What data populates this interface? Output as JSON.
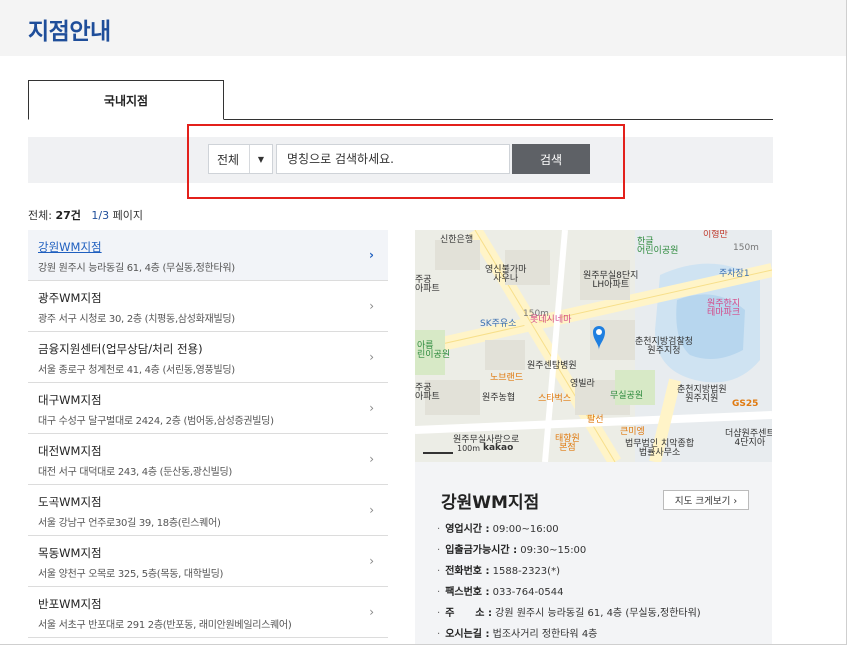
{
  "page": {
    "title": "지점안내"
  },
  "tabs": [
    {
      "label": "국내지점",
      "active": true
    }
  ],
  "search": {
    "category_selected": "전체",
    "dropdown_arrow": "▼",
    "placeholder": "명칭으로 검색하세요.",
    "button_label": "검색"
  },
  "summary": {
    "total_label": "전체:",
    "total_count": "27건",
    "page_current": "1/3",
    "page_suffix": "페이지"
  },
  "branches": [
    {
      "name": "강원WM지점",
      "address": "강원 원주시 능라동길 61, 4층 (무실동,정한타워)",
      "active": true
    },
    {
      "name": "광주WM지점",
      "address": "광주 서구 시청로 30, 2층 (치평동,삼성화재빌딩)",
      "active": false
    },
    {
      "name": "금융지원센터(업무상담/처리 전용)",
      "address": "서울 종로구 청계천로 41, 4층 (서린동,영풍빌딩)",
      "active": false
    },
    {
      "name": "대구WM지점",
      "address": "대구 수성구 달구벌대로 2424, 2층 (범어동,삼성증권빌딩)",
      "active": false
    },
    {
      "name": "대전WM지점",
      "address": "대전 서구 대덕대로 243, 4층 (둔산동,광신빌딩)",
      "active": false
    },
    {
      "name": "도곡WM지점",
      "address": "서울 강남구 언주로30길 39, 18층(린스퀘어)",
      "active": false
    },
    {
      "name": "목동WM지점",
      "address": "서울 양천구 오목로 325, 5층(목동, 대학빌딩)",
      "active": false
    },
    {
      "name": "반포WM지점",
      "address": "서울 서초구 반포대로 291 2층(반포동, 래미안원베일리스퀘어)",
      "active": false
    }
  ],
  "chevron": "›",
  "map": {
    "labels": {
      "shinhan": "신한은행",
      "hangeul_park": "한글\n어린이공원",
      "dist_150_top": "150m",
      "parking": "주차장1",
      "yeongshin": "영신불가마\n사우나",
      "wonju_musil": "원주무실8단지\nLH아파트",
      "wonju_theme": "원주한지\n테마파크",
      "apt_left": "주공\n아파트",
      "sk": "SK주유소",
      "lotte": "롯데시네마",
      "chuncheon_police": "춘천지방검찰청\n원주지청",
      "areum_park": "아름\n린이공원",
      "wonju_hosp": "원주센탐병원",
      "noteuraend": "노브랜드",
      "yeongbilla": "영빌라",
      "musil_park": "무실공원",
      "chuncheon_court": "춘천지방법원\n원주지원",
      "gs25": "GS25",
      "apt_left2": "주공\n아파트",
      "wonju_nonghyup": "원주농협",
      "starbucks": "스타벅스",
      "palsan": "팔선",
      "geumirung": "큰미엥",
      "deoksan": "더샵원주센트\n4단지아",
      "musil_sarang": "원주무실사랑으로",
      "taehyang": "태향원\n본점",
      "beopmu": "법무법인 치악종합\n법률사무소",
      "scale": "100m",
      "kakao": "kakao",
      "iryeongman": "이형만",
      "dist_150_mid": "150m"
    }
  },
  "detail": {
    "title": "강원WM지점",
    "map_button": "지도 크게보기  ›",
    "rows": [
      {
        "key": "영업시간 :",
        "value": "09:00~16:00"
      },
      {
        "key": "입출금가능시간 :",
        "value": "09:30~15:00"
      },
      {
        "key": "전화번호 :",
        "value": "1588-2323(*)"
      },
      {
        "key": "팩스번호 :",
        "value": "033-764-0544"
      },
      {
        "key": "주      소 :",
        "value": "강원 원주시 능라동길 61, 4층 (무실동,정한타워)"
      },
      {
        "key": "오시는길 :",
        "value": "법조사거리 정한타워 4층"
      }
    ]
  },
  "colors": {
    "title_blue": "#1f4e9a",
    "highlight_red": "#e3201b",
    "search_button": "#5e6166",
    "map_pin": "#1f7fe0"
  }
}
